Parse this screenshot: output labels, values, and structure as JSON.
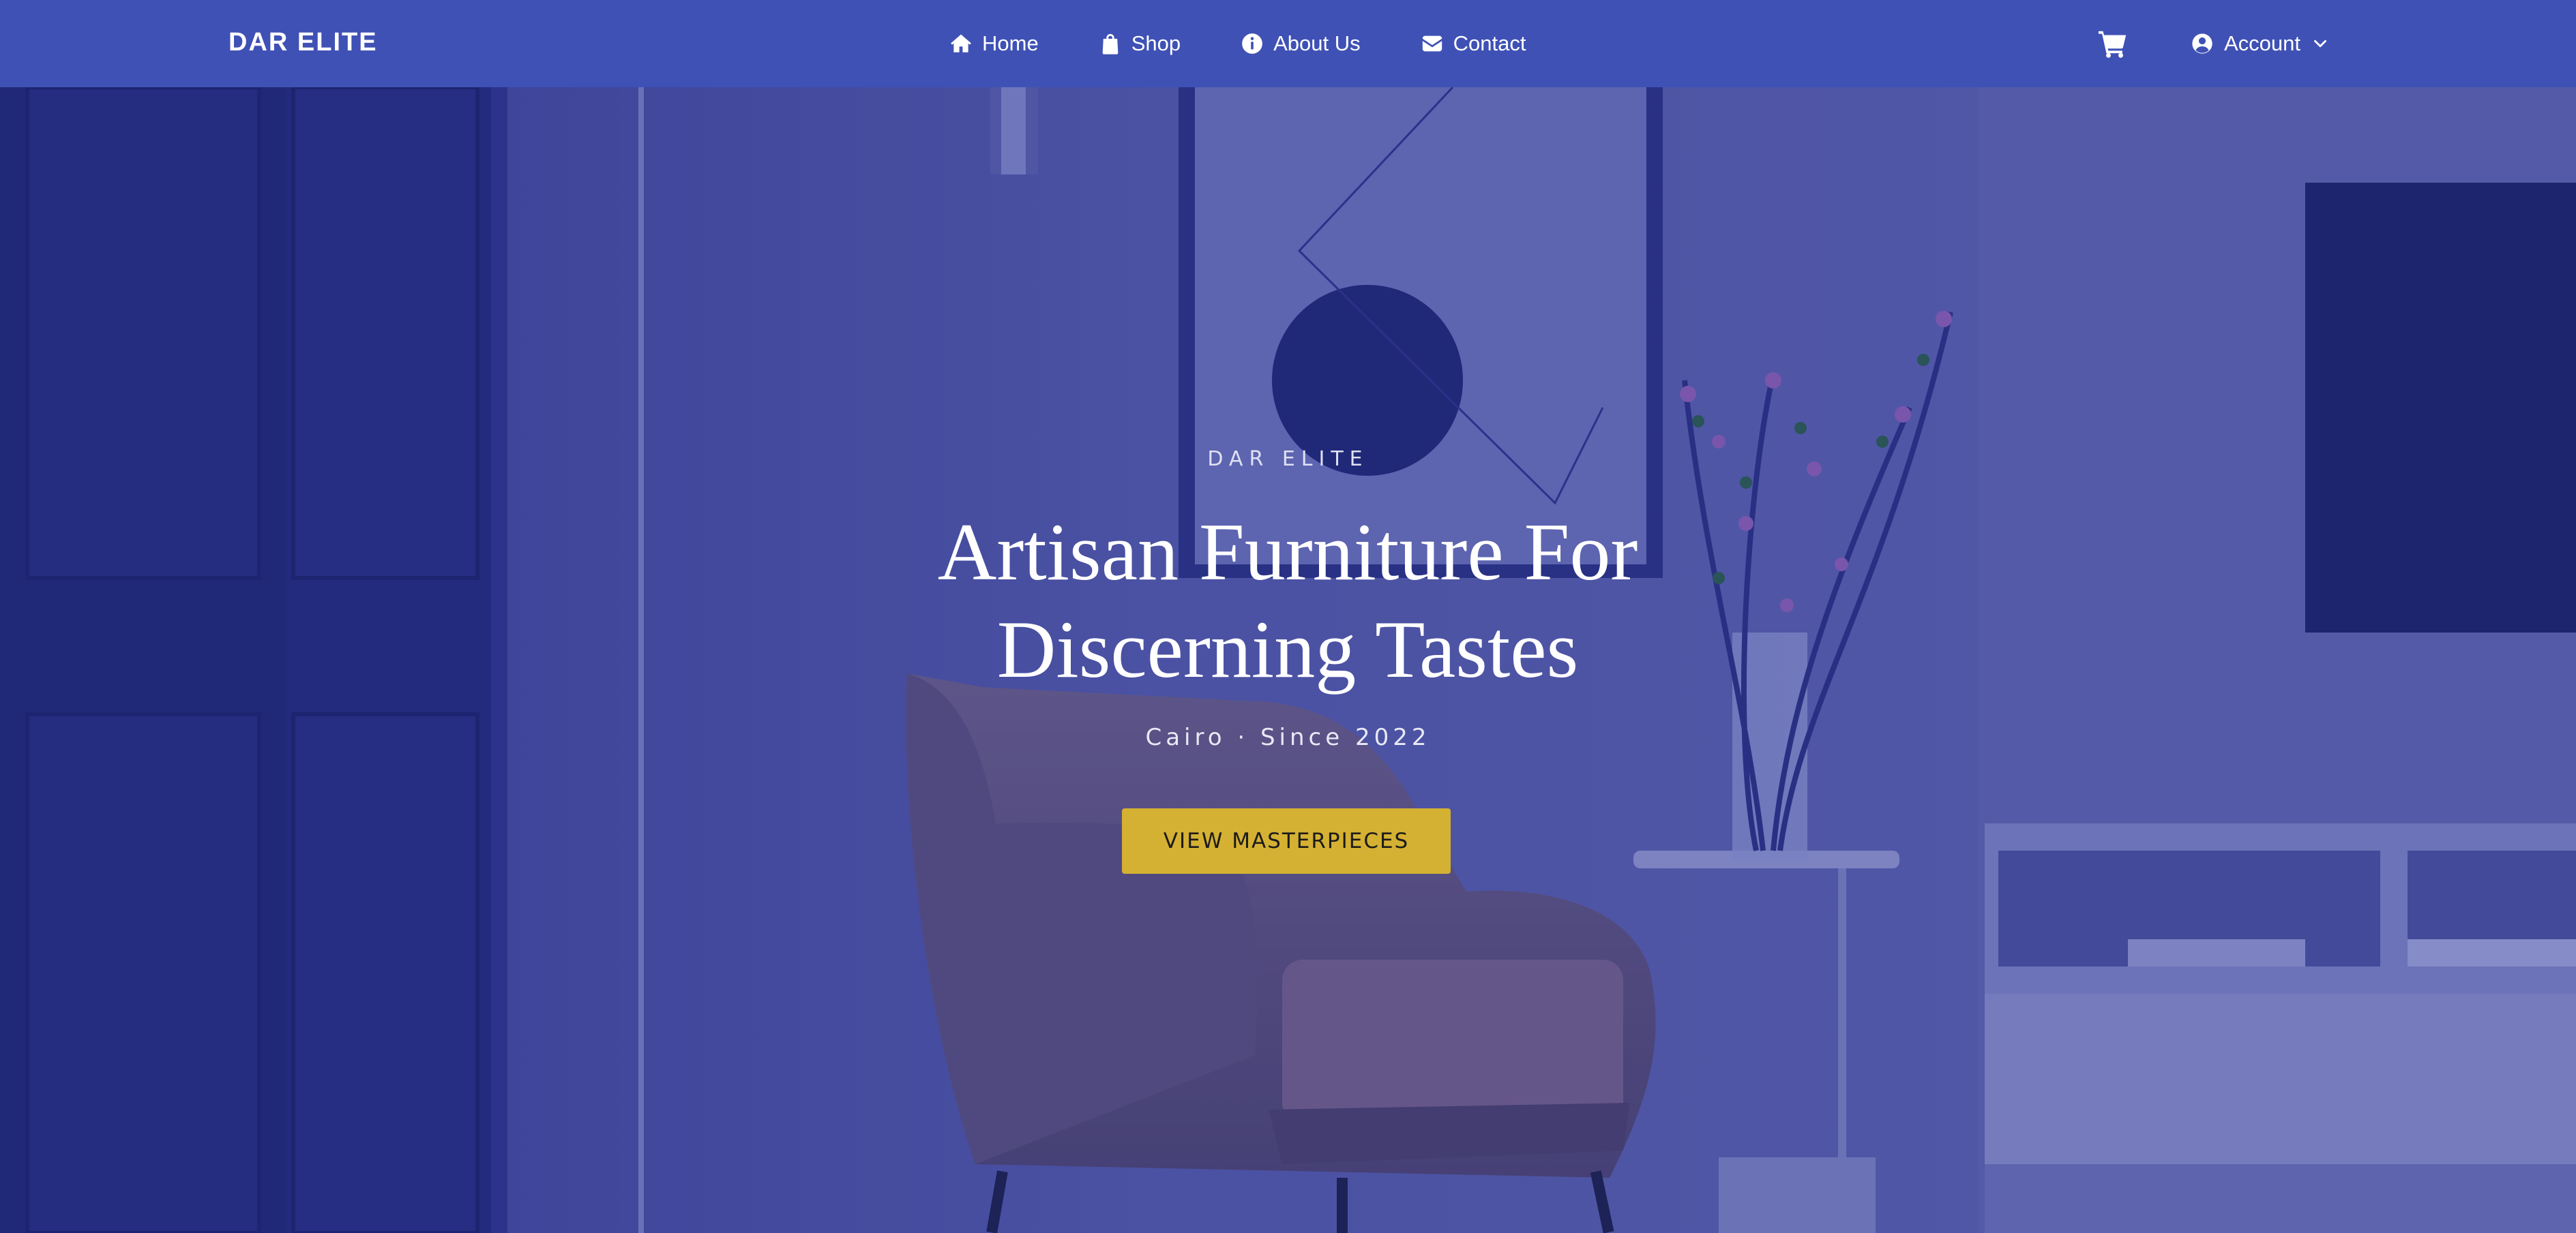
{
  "brand": {
    "name": "DAR ELITE"
  },
  "nav": {
    "items": [
      {
        "label": "Home",
        "icon": "home-icon"
      },
      {
        "label": "Shop",
        "icon": "shopping-bag-icon"
      },
      {
        "label": "About Us",
        "icon": "info-circle-icon"
      },
      {
        "label": "Contact",
        "icon": "envelope-icon"
      }
    ],
    "cart_icon": "shopping-cart-icon",
    "account": {
      "label": "Account",
      "icon": "user-circle-icon",
      "chevron_icon": "chevron-down-icon"
    }
  },
  "hero": {
    "eyebrow": "DAR ELITE",
    "title_line1": "Artisan Furniture For",
    "title_line2": "Discerning Tastes",
    "subtitle": "Cairo · Since 2022",
    "cta_label": "VIEW MASTERPIECES",
    "background_description_icon": "living-room-armchair-photo"
  },
  "colors": {
    "navbar": "#3f51b5",
    "hero_tint": "#4d53a0",
    "cta": "#d4b132",
    "text_light": "#ffffff"
  }
}
